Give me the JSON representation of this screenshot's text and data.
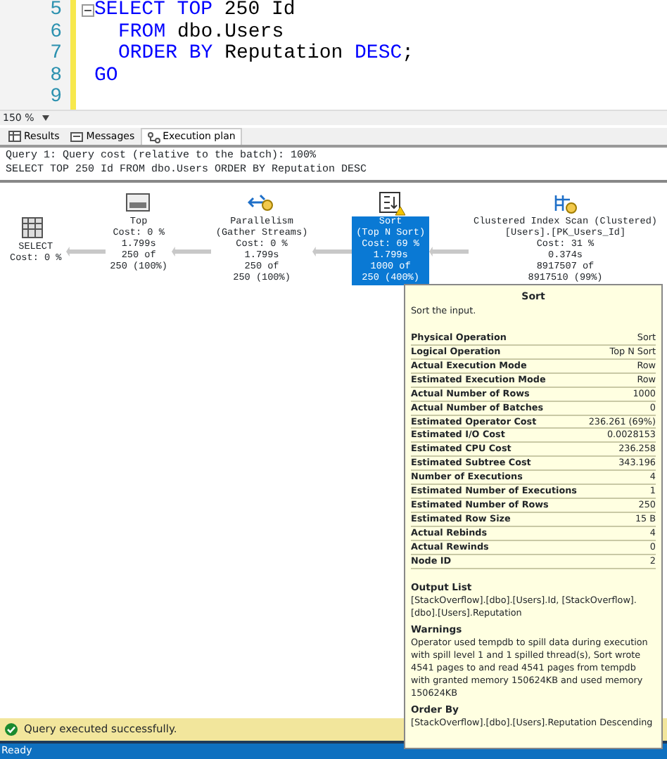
{
  "editor": {
    "lines": [
      {
        "number": "5",
        "collapsible": true,
        "tokens": [
          {
            "kind": "keyword",
            "text": "SELECT TOP"
          },
          {
            "kind": "plain",
            "text": "250 Id"
          }
        ]
      },
      {
        "number": "6",
        "collapsible": false,
        "tokens": [
          {
            "kind": "keyword",
            "text": "FROM"
          },
          {
            "kind": "plain",
            "text": "dbo.Users"
          }
        ]
      },
      {
        "number": "7",
        "collapsible": false,
        "tokens": [
          {
            "kind": "keyword",
            "text": "ORDER BY"
          },
          {
            "kind": "plain",
            "text": "Reputation"
          },
          {
            "kind": "keyword",
            "text": "DESC"
          },
          {
            "kind": "plain",
            "text": ";"
          }
        ]
      },
      {
        "number": "8",
        "collapsible": false,
        "tokens": [
          {
            "kind": "keyword",
            "text": "GO"
          }
        ]
      },
      {
        "number": "9",
        "collapsible": false
      }
    ],
    "zoom": "150 %"
  },
  "tabs": [
    {
      "label": "Results",
      "selected": false
    },
    {
      "label": "Messages",
      "selected": false
    },
    {
      "label": "Execution plan",
      "selected": true
    }
  ],
  "query_header": [
    "Query 1: Query cost (relative to the batch): 100%",
    "SELECT TOP 250 Id FROM dbo.Users ORDER BY Reputation DESC"
  ],
  "plan": {
    "nodes": [
      {
        "kind": "select",
        "lines": [
          "SELECT",
          "Cost: 0 %"
        ],
        "selected": false,
        "warning": false
      },
      {
        "kind": "top",
        "lines": [
          "Top",
          "Cost: 0 %",
          "1.799s",
          "250 of",
          "250 (100%)"
        ],
        "selected": false,
        "warning": false
      },
      {
        "kind": "parallelism",
        "lines": [
          "Parallelism",
          "(Gather Streams)",
          "Cost: 0 %",
          "1.799s",
          "250 of",
          "250 (100%)"
        ],
        "selected": false,
        "warning": false
      },
      {
        "kind": "sort",
        "lines": [
          "Sort",
          "(Top N Sort)",
          "Cost: 69 %",
          "1.799s",
          "1000 of",
          "250 (400%)"
        ],
        "selected": true,
        "warning": true
      },
      {
        "kind": "scan",
        "lines": [
          "Clustered Index Scan (Clustered)",
          "[Users].[PK_Users_Id]",
          "Cost: 31 %",
          "0.374s",
          "8917507 of",
          "8917510 (99%)"
        ],
        "selected": false,
        "warning": false
      }
    ]
  },
  "tooltip": {
    "title": "Sort",
    "description": "Sort the input.",
    "properties": [
      {
        "name": "Physical Operation",
        "value": "Sort"
      },
      {
        "name": "Logical Operation",
        "value": "Top N Sort"
      },
      {
        "name": "Actual Execution Mode",
        "value": "Row"
      },
      {
        "name": "Estimated Execution Mode",
        "value": "Row"
      },
      {
        "name": "Actual Number of Rows",
        "value": "1000"
      },
      {
        "name": "Actual Number of Batches",
        "value": "0"
      },
      {
        "name": "Estimated Operator Cost",
        "value": "236.261 (69%)"
      },
      {
        "name": "Estimated I/O Cost",
        "value": "0.0028153"
      },
      {
        "name": "Estimated CPU Cost",
        "value": "236.258"
      },
      {
        "name": "Estimated Subtree Cost",
        "value": "343.196"
      },
      {
        "name": "Number of Executions",
        "value": "4"
      },
      {
        "name": "Estimated Number of Executions",
        "value": "1"
      },
      {
        "name": "Estimated Number of Rows",
        "value": "250"
      },
      {
        "name": "Estimated Row Size",
        "value": "15 B"
      },
      {
        "name": "Actual Rebinds",
        "value": "4"
      },
      {
        "name": "Actual Rewinds",
        "value": "0"
      },
      {
        "name": "Node ID",
        "value": "2"
      }
    ],
    "sections": [
      {
        "heading": "Output List",
        "text": "[StackOverflow].[dbo].[Users].Id, [StackOverflow].[dbo].[Users].Reputation"
      },
      {
        "heading": "Warnings",
        "text": "Operator used tempdb to spill data during execution with spill level 1 and 1 spilled thread(s), Sort wrote 4541 pages to and read 4541 pages from tempdb with granted memory 150624KB and used memory 150624KB"
      },
      {
        "heading": "Order By",
        "text": "[StackOverflow].[dbo].[Users].Reputation Descending"
      }
    ]
  },
  "status": {
    "message": "Query executed successfully.",
    "bottom": "Ready"
  }
}
